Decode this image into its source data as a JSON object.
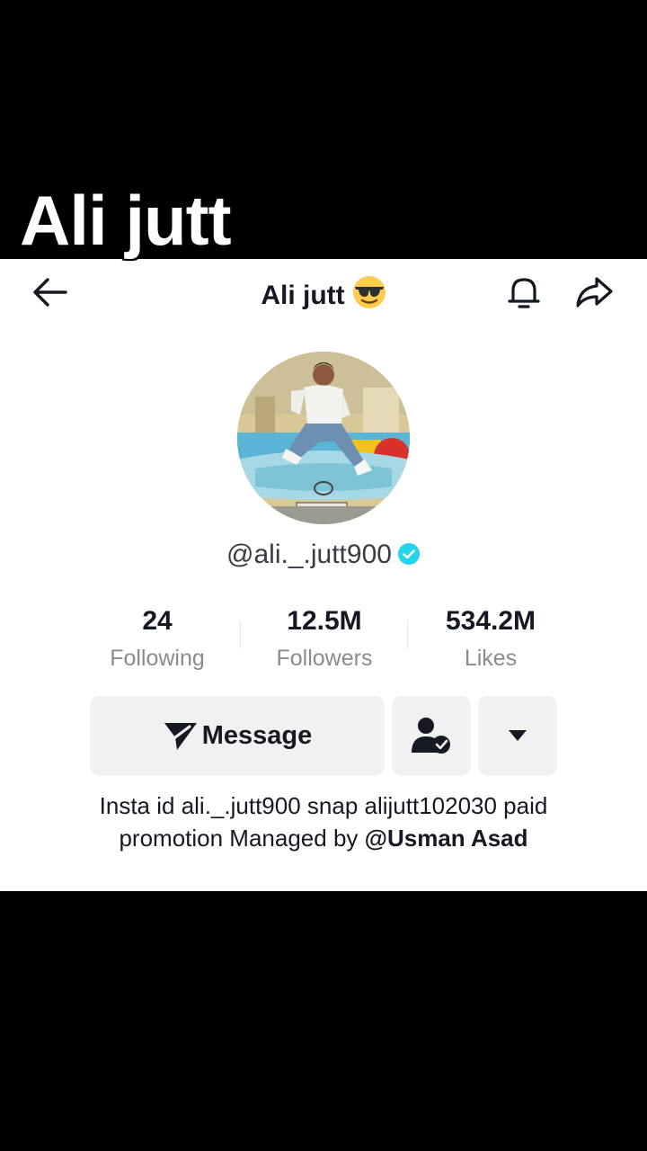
{
  "overlay": {
    "caption": "Ali jutt"
  },
  "header": {
    "title": "Ali jutt",
    "title_emoji": "sunglasses-emoji",
    "back_icon": "arrow-left-icon",
    "bell_icon": "bell-icon",
    "share_icon": "share-icon"
  },
  "profile": {
    "username": "@ali._.jutt900",
    "verified": true
  },
  "stats": [
    {
      "value": "24",
      "label": "Following"
    },
    {
      "value": "12.5M",
      "label": "Followers"
    },
    {
      "value": "534.2M",
      "label": "Likes"
    }
  ],
  "actions": {
    "message_label": "Message",
    "message_icon": "send-icon",
    "follow_icon": "user-check-icon",
    "more_icon": "caret-down-icon"
  },
  "bio": {
    "text": "Insta id ali._.jutt900 snap alijutt102030 paid promotion Managed by ",
    "mention": "@Usman Asad"
  },
  "colors": {
    "accent_verified": "#20d5ec",
    "text_primary": "#161823",
    "text_secondary": "#8a8b91",
    "button_bg": "#f1f1f2"
  }
}
